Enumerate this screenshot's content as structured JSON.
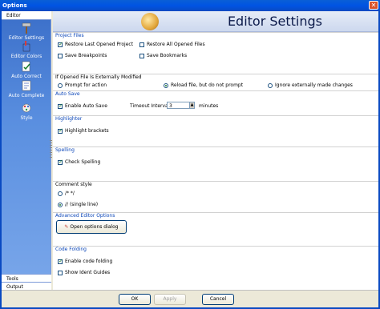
{
  "window": {
    "title": "Options",
    "close_glyph": "✕"
  },
  "leftnav": {
    "tab_label": "Editor",
    "items": [
      {
        "label": "Editor Settings",
        "icon": "hammer-icon"
      },
      {
        "label": "Editor Colors",
        "icon": "paint-icon"
      },
      {
        "label": "Auto Correct",
        "icon": "check-page-icon"
      },
      {
        "label": "Auto Complete",
        "icon": "page-icon"
      },
      {
        "label": "Style",
        "icon": "style-icon"
      }
    ],
    "bottom_tabs": [
      "Tools",
      "Output"
    ]
  },
  "header": {
    "title": "Editor Settings"
  },
  "project_files": {
    "heading": "Project Files",
    "options": [
      {
        "label": "Restore Last Opened Project",
        "checked": true
      },
      {
        "label": "Restore All Opened Files",
        "checked": false
      },
      {
        "label": "Save Breakpoints",
        "checked": false
      },
      {
        "label": "Save Bookmarks",
        "checked": false
      }
    ]
  },
  "external_mod": {
    "heading": "If Opened File Is Externally Modified",
    "options": [
      {
        "label": "Prompt for action",
        "selected": false
      },
      {
        "label": "Reload file, but do not prompt",
        "selected": true
      },
      {
        "label": "Ignore externally made changes",
        "selected": false
      }
    ]
  },
  "auto_save": {
    "heading": "Auto Save",
    "enable_label": "Enable Auto Save",
    "enable_checked": true,
    "timeout_label": "Timeout Interval:",
    "timeout_value": "3",
    "unit_label": "minutes"
  },
  "highlighter": {
    "heading": "Highlighter",
    "option_label": "Highlight brackets",
    "checked": true
  },
  "spelling": {
    "heading": "Spelling",
    "option_label": "Check Spelling",
    "checked": true
  },
  "comment_style": {
    "heading": "Comment style",
    "options": [
      {
        "label": "/* */",
        "selected": false
      },
      {
        "label": "// (single line)",
        "selected": true
      }
    ]
  },
  "advanced": {
    "heading": "Advanced Editor Options",
    "button_label": "Open options dialog"
  },
  "code_folding": {
    "heading": "Code Folding",
    "options": [
      {
        "label": "Enable code folding",
        "checked": true
      },
      {
        "label": "Show Ident Guides",
        "checked": false
      }
    ]
  },
  "footer": {
    "ok_label": "OK",
    "apply_label": "Apply",
    "cancel_label": "Cancel"
  }
}
